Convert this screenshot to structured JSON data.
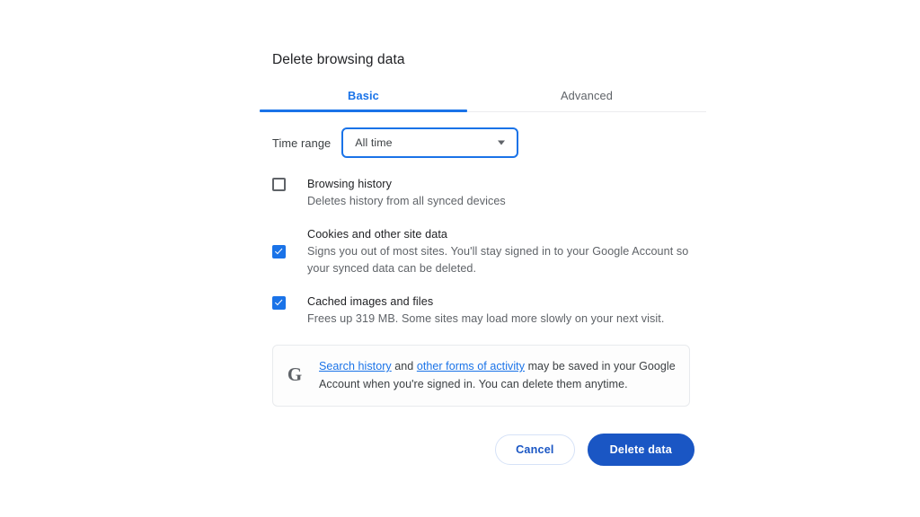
{
  "dialog": {
    "title": "Delete browsing data"
  },
  "tabs": [
    {
      "label": "Basic",
      "active": true
    },
    {
      "label": "Advanced",
      "active": false
    }
  ],
  "time_range": {
    "label": "Time range",
    "selected": "All time",
    "arrow_icon": "chevron-down-icon"
  },
  "options": [
    {
      "title": "Browsing history",
      "description": "Deletes history from all synced devices",
      "checked": false
    },
    {
      "title": "Cookies and other site data",
      "description": "Signs you out of most sites. You'll stay signed in to your Google Account so your synced data can be deleted.",
      "checked": true
    },
    {
      "title": "Cached images and files",
      "description": "Frees up 319 MB. Some sites may load more slowly on your next visit.",
      "checked": true
    }
  ],
  "info_box": {
    "icon": "google-g-icon",
    "link_one": "Search history",
    "between_text": " and ",
    "link_two": "other forms of activity",
    "rest_text": " may be saved in your Google Account when you're signed in. You can delete them anytime."
  },
  "footer": {
    "cancel_label": "Cancel",
    "delete_label": "Delete data"
  },
  "colors": {
    "accent_blue": "#1a73e8",
    "primary_button": "#1a56c4",
    "text_primary": "#202124",
    "text_secondary": "#5f6368",
    "divider": "#ececee"
  }
}
